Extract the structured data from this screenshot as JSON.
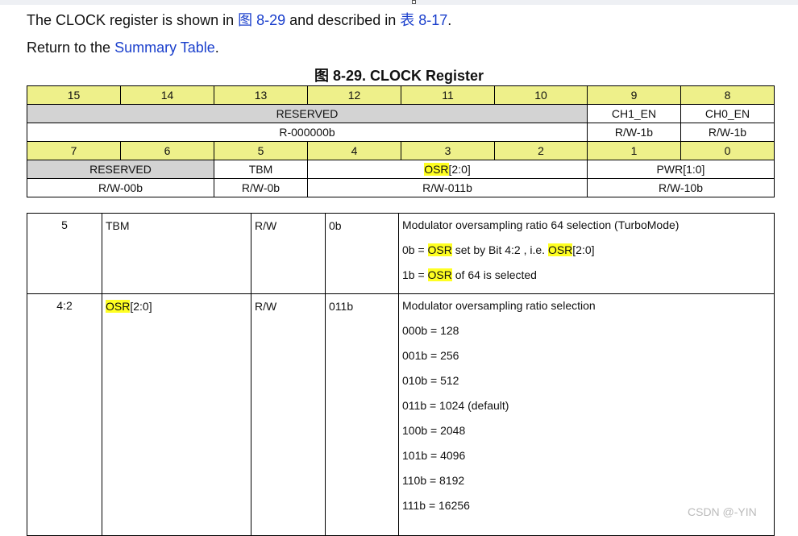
{
  "intro": {
    "before": "The CLOCK register is shown in ",
    "fig_link": "图 8-29",
    "middle": " and described in ",
    "table_link": "表 8-17",
    "after": "."
  },
  "return": {
    "before": "Return to the ",
    "link": "Summary Table",
    "after": "."
  },
  "figure_caption": "图 8-29. CLOCK Register",
  "register": {
    "high_bits": [
      "15",
      "14",
      "13",
      "12",
      "11",
      "10",
      "9",
      "8"
    ],
    "high_fields": [
      "RESERVED",
      "CH1_EN",
      "CH0_EN"
    ],
    "high_access": [
      "R-000000b",
      "R/W-1b",
      "R/W-1b"
    ],
    "low_bits": [
      "7",
      "6",
      "5",
      "4",
      "3",
      "2",
      "1",
      "0"
    ],
    "low_fields": {
      "reserved": "RESERVED",
      "tbm": "TBM",
      "osr_name": "OSR",
      "osr_range": "[2:0]",
      "pwr": "PWR[1:0]"
    },
    "low_access": [
      "R/W-00b",
      "R/W-0b",
      "R/W-011b",
      "R/W-10b"
    ]
  },
  "fields": [
    {
      "bit": "5",
      "field": "TBM",
      "type": "R/W",
      "reset": "0b",
      "desc_title": "Modulator oversampling ratio 64 selection (TurboMode)",
      "line1": {
        "pre": "0b = ",
        "osr1": "OSR",
        "mid": " set by Bit 4:2 , i.e. ",
        "osr2": "OSR",
        "post": "[2:0]"
      },
      "line2": {
        "pre": "1b = ",
        "osr": "OSR",
        "post": " of 64 is selected"
      }
    },
    {
      "bit": "4:2",
      "field_name": "OSR",
      "field_range": "[2:0]",
      "type": "R/W",
      "reset": "011b",
      "desc_title": "Modulator oversampling ratio selection",
      "options": [
        "000b = 128",
        "001b = 256",
        "010b = 512",
        "011b = 1024 (default)",
        "100b = 2048",
        "101b = 4096",
        "110b = 8192",
        "111b = 16256"
      ]
    }
  ],
  "watermark": "CSDN @-YIN",
  "colors": {
    "highlight": "#ffff22",
    "bit_header": "#eef08a",
    "reserved_gray": "#d3d3d3",
    "link": "#1a3fcc"
  }
}
